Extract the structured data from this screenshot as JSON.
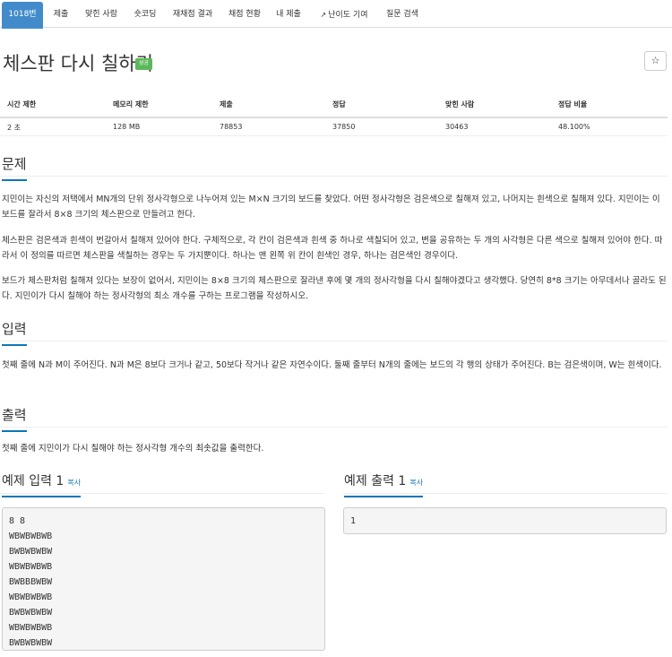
{
  "tabs": [
    {
      "label": "1018번",
      "active": true
    },
    {
      "label": "제출"
    },
    {
      "label": "맞힌 사람"
    },
    {
      "label": "숏코딩"
    },
    {
      "label": "재채점 결과"
    },
    {
      "label": "채점 현황"
    },
    {
      "label": "내 제출"
    },
    {
      "label": "난이도 기여",
      "icon": "external-link-icon"
    },
    {
      "label": "질문 검색"
    }
  ],
  "problem": {
    "title": "체스판 다시 칠하기",
    "badge": "성공",
    "star": "☆"
  },
  "stats": {
    "headers": [
      "시간 제한",
      "메모리 제한",
      "제출",
      "정답",
      "맞힌 사람",
      "정답 비율"
    ],
    "values": [
      "2 초",
      "128 MB",
      "78853",
      "37850",
      "30463",
      "48.100%"
    ]
  },
  "sections": {
    "description": {
      "heading": "문제",
      "paragraphs": [
        "지민이는 자신의 저택에서 MN개의 단위 정사각형으로 나누어져 있는 M×N 크기의 보드를 찾았다. 어떤 정사각형은 검은색으로 칠해져 있고, 나머지는 흰색으로 칠해져 있다. 지민이는 이 보드를 잘라서 8×8 크기의 체스판으로 만들려고 한다.",
        "체스판은 검은색과 흰색이 번갈아서 칠해져 있어야 한다. 구체적으로, 각 칸이 검은색과 흰색 중 하나로 색칠되어 있고, 변을 공유하는 두 개의 사각형은 다른 색으로 칠해져 있어야 한다. 따라서 이 정의를 따르면 체스판을 색칠하는 경우는 두 가지뿐이다. 하나는 맨 왼쪽 위 칸이 흰색인 경우, 하나는 검은색인 경우이다.",
        "보드가 체스판처럼 칠해져 있다는 보장이 없어서, 지민이는 8×8 크기의 체스판으로 잘라낸 후에 몇 개의 정사각형을 다시 칠해야겠다고 생각했다. 당연히 8*8 크기는 아무데서나 골라도 된다. 지민이가 다시 칠해야 하는 정사각형의 최소 개수를 구하는 프로그램을 작성하시오."
      ]
    },
    "input": {
      "heading": "입력",
      "text": "첫째 줄에 N과 M이 주어진다. N과 M은 8보다 크거나 같고, 50보다 작거나 같은 자연수이다. 둘째 줄부터 N개의 줄에는 보드의 각 행의 상태가 주어진다. B는 검은색이며, W는 흰색이다."
    },
    "output": {
      "heading": "출력",
      "text": "첫째 줄에 지민이가 다시 칠해야 하는 정사각형 개수의 최솟값을 출력한다."
    }
  },
  "examples": {
    "input": {
      "heading": "예제 입력 1",
      "copy": "복사",
      "content": "8 8\nWBWBWBWB\nBWBWBWBW\nWBWBWBWB\nBWBBBWBW\nWBWBWBWB\nBWBWBWBW\nWBWBWBWB\nBWBWBWBW"
    },
    "output": {
      "heading": "예제 출력 1",
      "copy": "복사",
      "content": "1"
    }
  }
}
